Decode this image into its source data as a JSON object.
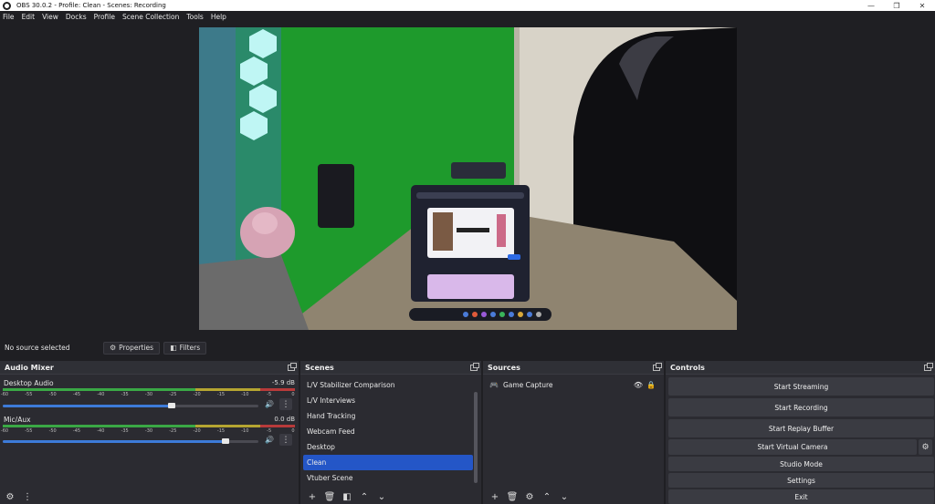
{
  "window": {
    "title": "OBS 30.0.2 - Profile: Clean - Scenes: Recording"
  },
  "menu": [
    "File",
    "Edit",
    "View",
    "Docks",
    "Profile",
    "Scene Collection",
    "Tools",
    "Help"
  ],
  "source_bar": {
    "status": "No source selected",
    "properties_label": "Properties",
    "filters_label": "Filters"
  },
  "audio_mixer": {
    "title": "Audio Mixer",
    "scale": [
      "-60",
      "-55",
      "-50",
      "-45",
      "-40",
      "-35",
      "-30",
      "-25",
      "-20",
      "-15",
      "-10",
      "-5",
      "0"
    ],
    "channels": [
      {
        "name": "Desktop Audio",
        "db": "-5.9 dB",
        "volume": 0.66
      },
      {
        "name": "Mic/Aux",
        "db": "0.0 dB",
        "volume": 0.87
      }
    ]
  },
  "scenes": {
    "title": "Scenes",
    "items": [
      "L/V Stabilizer Comparison",
      "L/V Interviews",
      "Hand Tracking",
      "Webcam Feed",
      "Desktop",
      "Clean",
      "Vtuber Scene"
    ],
    "selected": "Clean"
  },
  "sources": {
    "title": "Sources",
    "items": [
      {
        "name": "Game Capture"
      }
    ]
  },
  "controls": {
    "title": "Controls",
    "buttons": [
      "Start Streaming",
      "Start Recording",
      "Start Replay Buffer",
      "Start Virtual Camera",
      "Studio Mode",
      "Settings",
      "Exit"
    ]
  },
  "colors": {
    "accent": "#2456c7",
    "volume": "#3d7bd9",
    "meter_green": "#3aa845",
    "meter_yellow": "#b5a531",
    "meter_red": "#b83a3a"
  }
}
